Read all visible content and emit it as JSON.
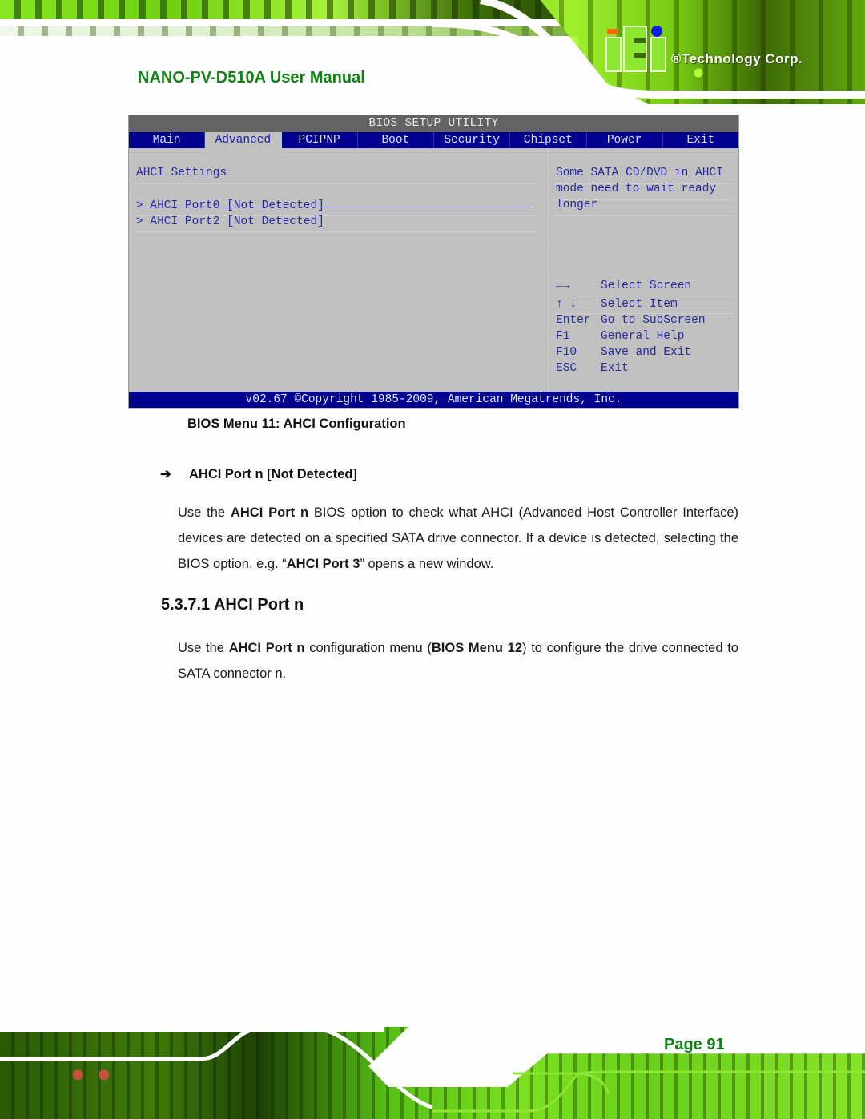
{
  "header": {
    "manual_title": "NANO-PV-D510A User Manual",
    "brand": "®Technology Corp.",
    "logo_text": "iEi"
  },
  "bios": {
    "title": "BIOS SETUP UTILITY",
    "tabs": [
      {
        "label": "Main",
        "active": false
      },
      {
        "label": "Advanced",
        "active": true
      },
      {
        "label": "PCIPNP",
        "active": false
      },
      {
        "label": "Boot",
        "active": false
      },
      {
        "label": "Security",
        "active": false
      },
      {
        "label": "Chipset",
        "active": false
      },
      {
        "label": "Power",
        "active": false
      },
      {
        "label": "Exit",
        "active": false
      }
    ],
    "section_title": "AHCI Settings",
    "items": [
      "> AHCI Port0 [Not Detected]",
      "> AHCI Port2 [Not Detected]"
    ],
    "help_lines": [
      "Some SATA CD/DVD in AHCI",
      "mode need to wait ready",
      "longer"
    ],
    "keys": [
      {
        "key": "←→",
        "action": "Select Screen"
      },
      {
        "key": "↑ ↓",
        "action": "Select Item"
      },
      {
        "key": "Enter",
        "action": "Go to SubScreen"
      },
      {
        "key": "F1",
        "action": "General Help"
      },
      {
        "key": "F10",
        "action": "Save and Exit"
      },
      {
        "key": "ESC",
        "action": "Exit"
      }
    ],
    "footer": "v02.67 ©Copyright 1985-2009, American Megatrends, Inc."
  },
  "document": {
    "caption": "BIOS Menu 11: AHCI Configuration",
    "option_arrow": "➔",
    "option_heading": "AHCI Port n [Not Detected]",
    "para1": {
      "t1": "Use the ",
      "b1": "AHCI Port n",
      "t2": " BIOS option to check what AHCI (Advanced Host Controller Interface) devices are detected on a specified SATA drive connector. If a device is detected, selecting the BIOS option, e.g. “",
      "b2": "AHCI Port 3",
      "t3": "” opens a new window."
    },
    "section_heading": "5.3.7.1 AHCI Port n",
    "para2": {
      "t1": "Use the ",
      "b1": "AHCI Port n",
      "t2": " configuration menu (",
      "b2": "BIOS Menu 12",
      "t3": ") to configure the drive connected to SATA connector n."
    }
  },
  "footer": {
    "page_label": "Page 91"
  }
}
